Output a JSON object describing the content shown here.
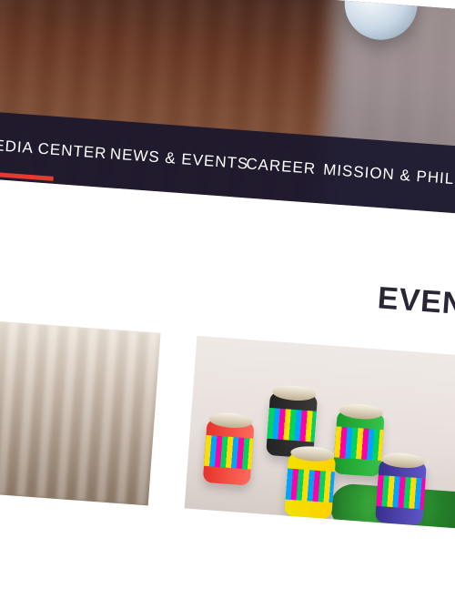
{
  "nav": {
    "items": [
      {
        "label": "MEDIA CENTER"
      },
      {
        "label": "NEWS & EVENTS"
      },
      {
        "label": "CAREER"
      },
      {
        "label": "MISSION & PHILO"
      }
    ],
    "active_index": 0,
    "active_underline_color": "#e23b2f"
  },
  "section": {
    "title": "EVEN"
  },
  "colors": {
    "nav_background": "#19162c",
    "title_text": "#2b2636"
  }
}
